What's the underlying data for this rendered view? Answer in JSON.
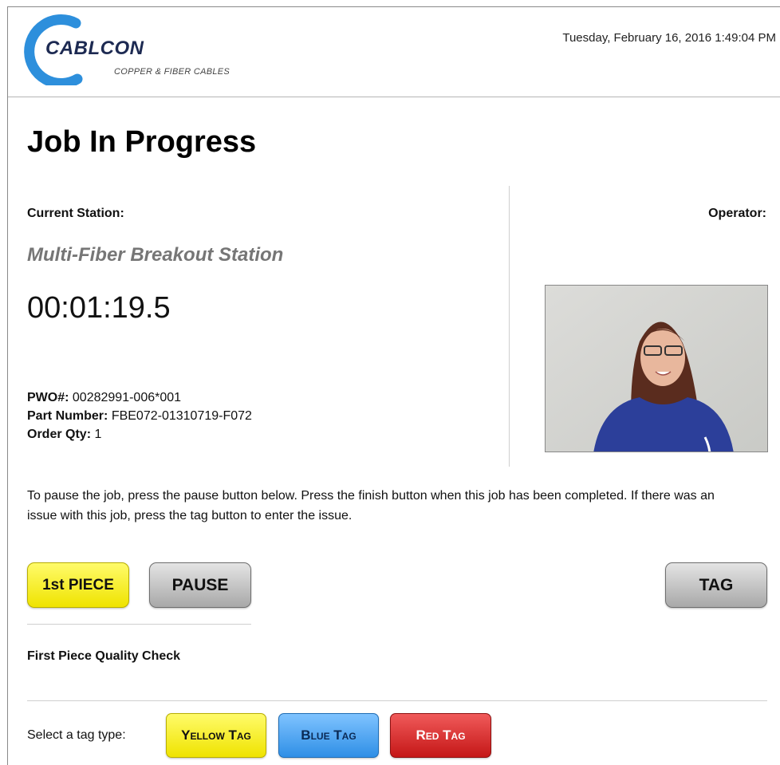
{
  "header": {
    "logo_name": "CABLCON",
    "logo_tagline": "COPPER & FIBER CABLES",
    "datetime": "Tuesday, February 16, 2016 1:49:04 PM",
    "brand_color": "#2d8fdc"
  },
  "page": {
    "title": "Job In Progress"
  },
  "station": {
    "label": "Current Station:",
    "name": "Multi-Fiber Breakout Station",
    "timer": "00:01:19.5"
  },
  "operator": {
    "label": "Operator:",
    "photo_icon": "operator-photo"
  },
  "job": {
    "pwo_label": "PWO#:",
    "pwo_value": "00282991-006*001",
    "part_label": "Part Number:",
    "part_value": "FBE072-01310719-F072",
    "qty_label": "Order Qty:",
    "qty_value": "1"
  },
  "instructions": "To pause the job, press the pause button below. Press the finish button when this job has been completed. If there was an issue with this job, press the tag button to enter the issue.",
  "buttons": {
    "first_piece": "1st PIECE",
    "pause": "PAUSE",
    "tag": "TAG"
  },
  "quality_check": {
    "title": "First Piece Quality Check"
  },
  "tag_select": {
    "label": "Select a tag type:",
    "yellow": "Yellow Tag",
    "blue": "Blue Tag",
    "red": "Red Tag",
    "colors": {
      "yellow": "#efe300",
      "blue": "#2f8fe6",
      "red": "#c51717"
    }
  }
}
